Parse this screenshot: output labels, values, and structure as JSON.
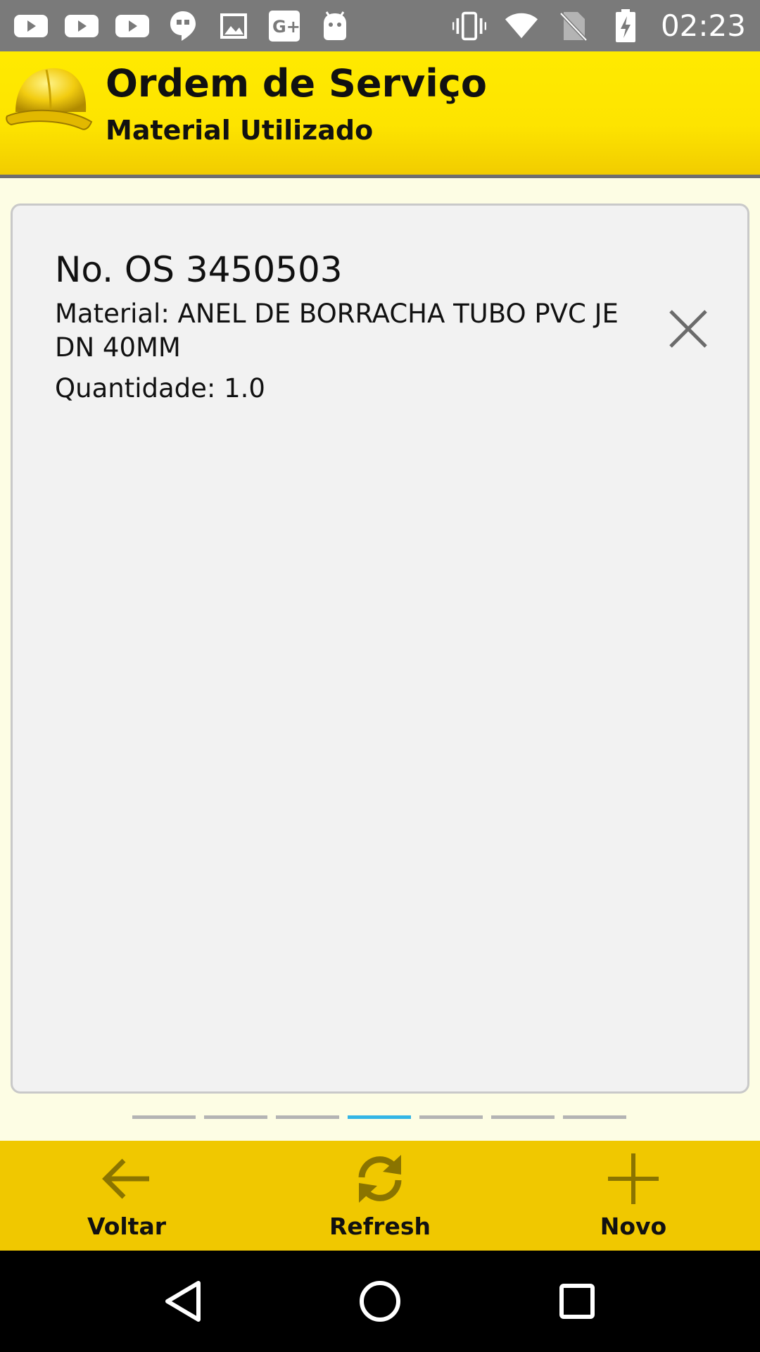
{
  "status_bar": {
    "time": "02:23",
    "left_icons": [
      "youtube-icon",
      "youtube-icon",
      "youtube-icon",
      "hangouts-icon",
      "image-icon",
      "google-plus-icon",
      "android-icon"
    ],
    "right_icons": [
      "vibrate-icon",
      "wifi-icon",
      "no-sim-icon",
      "battery-charging-icon"
    ]
  },
  "header": {
    "title": "Ordem de Serviço",
    "subtitle": "Material Utilizado",
    "logo_icon": "helmet-icon"
  },
  "card": {
    "os_number": "No. OS 3450503",
    "material": "Material: ANEL DE BORRACHA TUBO PVC JE DN 40MM",
    "quantity": "Quantidade: 1.0",
    "delete_icon": "close-icon"
  },
  "pager": {
    "total": 7,
    "active_index": 3
  },
  "toolbar": {
    "back_label": "Voltar",
    "refresh_label": "Refresh",
    "new_label": "Novo"
  },
  "colors": {
    "header_yellow": "#ffea00",
    "toolbar_yellow": "#f0c800",
    "icon_olive": "#8a7400",
    "pager_active": "#33b5e5",
    "status_gray": "#7a7a7a"
  }
}
